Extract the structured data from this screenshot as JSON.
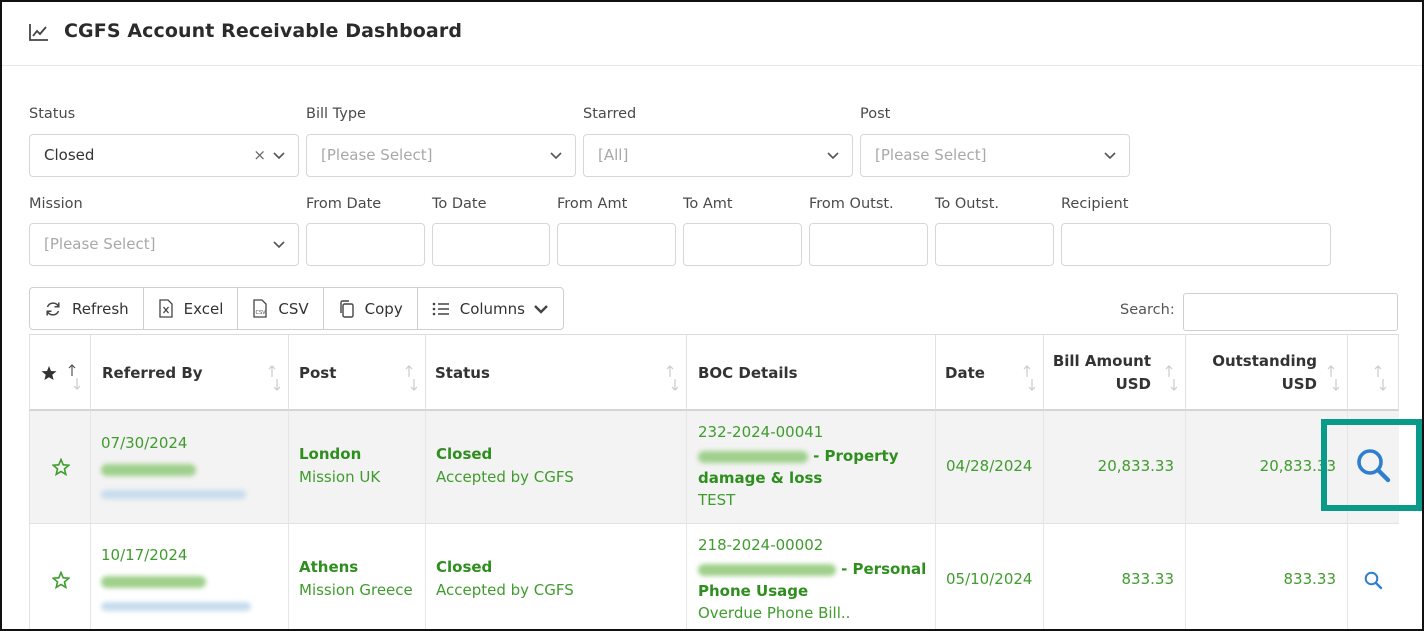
{
  "header": {
    "title": "CGFS Account Receivable Dashboard",
    "icon": "line-chart-icon"
  },
  "filters": {
    "status": {
      "label": "Status",
      "value": "Closed"
    },
    "bill_type": {
      "label": "Bill Type",
      "placeholder": "[Please Select]"
    },
    "starred": {
      "label": "Starred",
      "placeholder": "[All]"
    },
    "post": {
      "label": "Post",
      "placeholder": "[Please Select]"
    },
    "mission": {
      "label": "Mission",
      "placeholder": "[Please Select]"
    },
    "from_date": {
      "label": "From Date"
    },
    "to_date": {
      "label": "To Date"
    },
    "from_amt": {
      "label": "From Amt"
    },
    "to_amt": {
      "label": "To Amt"
    },
    "from_outst": {
      "label": "From Outst."
    },
    "to_outst": {
      "label": "To Outst."
    },
    "recipient": {
      "label": "Recipient"
    }
  },
  "toolbar": {
    "refresh": "Refresh",
    "excel": "Excel",
    "csv": "CSV",
    "copy": "Copy",
    "columns": "Columns",
    "search_label": "Search:"
  },
  "table": {
    "headers": {
      "referred_by": "Referred By",
      "post": "Post",
      "status": "Status",
      "boc": "BOC Details",
      "date": "Date",
      "bill_amount_1": "Bill Amount",
      "bill_amount_2": "USD",
      "outstanding_1": "Outstanding",
      "outstanding_2": "USD"
    },
    "rows": [
      {
        "referred_date": "07/30/2024",
        "post_city": "London",
        "post_mission": "Mission UK",
        "status": "Closed",
        "status_detail": "Accepted by CGFS",
        "boc_id": "232-2024-00041",
        "boc_title_a": "- Property",
        "boc_title_b": "damage & loss",
        "boc_note": "TEST",
        "date": "04/28/2024",
        "bill_amount": "20,833.33",
        "outstanding": "20,833.33"
      },
      {
        "referred_date": "10/17/2024",
        "post_city": "Athens",
        "post_mission": "Mission Greece",
        "status": "Closed",
        "status_detail": "Accepted by CGFS",
        "boc_id": "218-2024-00002",
        "boc_title_a": "- Personal",
        "boc_title_b": "Phone Usage",
        "boc_note": "Overdue Phone Bill..",
        "date": "05/10/2024",
        "bill_amount": "833.33",
        "outstanding": "833.33"
      }
    ]
  },
  "colors": {
    "accent_green": "#3f9c2d",
    "highlight_teal": "#0a9a8a",
    "link_blue": "#2f7fd1"
  }
}
